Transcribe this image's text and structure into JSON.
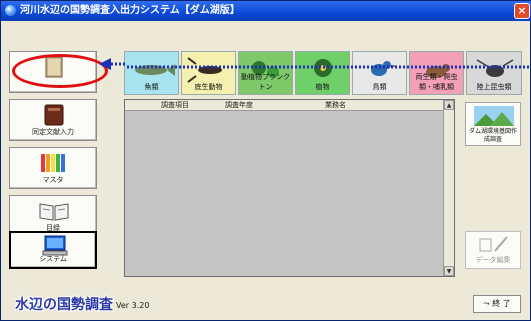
{
  "window": {
    "title": "河川水辺の国勢調査入出力システム【ダム湖版】",
    "close_glyph": "×"
  },
  "left_buttons": [
    {
      "label": ""
    },
    {
      "label": "同定文献入力"
    },
    {
      "label": "マスタ"
    },
    {
      "label": "目録"
    },
    {
      "label": "システム"
    }
  ],
  "categories": [
    {
      "label": "魚類",
      "bg": "#a8e3f0"
    },
    {
      "label": "底生動物",
      "bg": "#f3f0b0"
    },
    {
      "label": "動植物プランクトン",
      "bg": "#7fc96a"
    },
    {
      "label": "植物",
      "bg": "#6fd06a"
    },
    {
      "label": "鳥類",
      "bg": "#e8e8e8"
    },
    {
      "label": "両生類・爬虫類・哺乳類",
      "bg": "#f2a0b8"
    },
    {
      "label": "陸上昆虫類",
      "bg": "#d8d8d8"
    }
  ],
  "table": {
    "columns": [
      "調査項目",
      "調査年度",
      "業務名"
    ]
  },
  "right_buttons": [
    {
      "label": "ダム湖環境基図作成調査"
    },
    {
      "label": "データ編集"
    }
  ],
  "footer": {
    "logo": "水辺の国勢調査",
    "version": "Ver 3.20",
    "exit_label": "終 了"
  },
  "colors": {
    "accent_blue": "#0a46d0",
    "annotation_red": "#e01010",
    "annotation_blue": "#1d2fb8"
  }
}
